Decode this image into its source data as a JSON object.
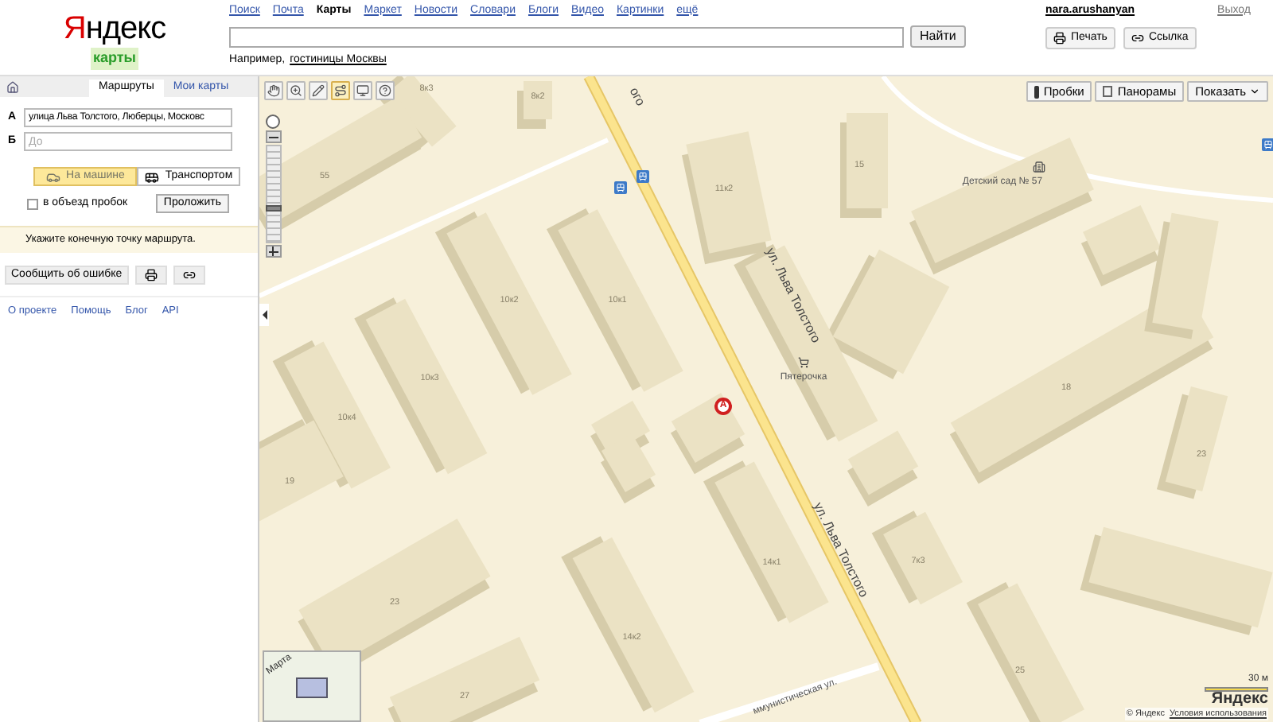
{
  "header": {
    "logo": "Яндекс",
    "service": "карты",
    "nav": [
      {
        "label": "Поиск",
        "selected": false
      },
      {
        "label": "Почта",
        "selected": false
      },
      {
        "label": "Карты",
        "selected": true
      },
      {
        "label": "Маркет",
        "selected": false
      },
      {
        "label": "Новости",
        "selected": false
      },
      {
        "label": "Словари",
        "selected": false
      },
      {
        "label": "Блоги",
        "selected": false
      },
      {
        "label": "Видео",
        "selected": false
      },
      {
        "label": "Картинки",
        "selected": false
      },
      {
        "label": "ещё",
        "selected": false
      }
    ],
    "search_button": "Найти",
    "example_prefix": "Например,",
    "example_link": "гостиницы Москвы",
    "user": "nara.arushanyan",
    "logout": "Выход",
    "actions": [
      "Печать",
      "Ссылка"
    ]
  },
  "sidebar": {
    "tabs": [
      {
        "label": "Маршруты",
        "selected": true
      },
      {
        "label": "Мои карты",
        "selected": false
      }
    ],
    "from": {
      "marker": "А",
      "value": "улица Льва Толстого, Люберцы, Московс"
    },
    "to": {
      "marker": "Б",
      "placeholder": "До"
    },
    "modes": [
      {
        "label": "На машине",
        "selected": true
      },
      {
        "label": "Транспортом",
        "selected": false
      }
    ],
    "avoid_traffic": {
      "label": "в объезд пробок",
      "checked": false
    },
    "route_button": "Проложить",
    "notice": "Укажите конечную точку маршрута.",
    "report_button": "Сообщить об ошибке",
    "footer_links": [
      "О проекте",
      "Помощь",
      "Блог",
      "API"
    ]
  },
  "map": {
    "tools": [
      {
        "selected": false
      },
      {
        "selected": false
      },
      {
        "selected": false
      },
      {
        "selected": true
      },
      {
        "selected": false
      },
      {
        "selected": false
      }
    ],
    "zoom": {
      "level": 0.35
    },
    "layers": [
      "Пробки",
      "Панорамы"
    ],
    "show_menu": "Показать",
    "street_labels": [
      "ого",
      "ул. Льва Толстого",
      "ул. Льва Толстого"
    ],
    "side_street": "ммунистическая ул.",
    "building_labels": [
      "8к3",
      "8к2",
      "55",
      "11к2",
      "15",
      "10к2",
      "10к1",
      "10к3",
      "10к4",
      "18",
      "23",
      "14к1",
      "7к3",
      "23",
      "14к2",
      "25",
      "27",
      "19"
    ],
    "places": [
      "Детский сад № 57",
      "Пятерочка"
    ],
    "marker": "А",
    "minimap_label": "Марта",
    "scale": "30 м",
    "brand": "Яндекс",
    "copyright": "© Яндекс",
    "terms": "Условия использования"
  }
}
